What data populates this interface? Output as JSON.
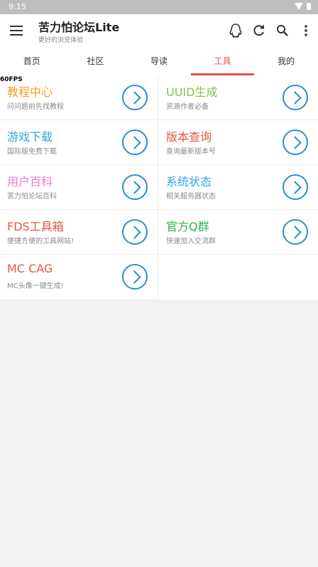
{
  "status_bar": {
    "time": "9:15"
  },
  "app_bar": {
    "title": "苦力怕论坛Lite",
    "subtitle": "更好的浏览体验",
    "actions": [
      "qq-icon",
      "refresh-icon",
      "search-icon",
      "more-vert-icon"
    ]
  },
  "tabs": [
    {
      "label": "首页"
    },
    {
      "label": "社区"
    },
    {
      "label": "导读"
    },
    {
      "label": "工具"
    },
    {
      "label": "我的"
    }
  ],
  "active_tab": "工具",
  "fps": "60FPS",
  "colors": {
    "accent": "#e84e58",
    "arrow": "#2b8fd0"
  },
  "tools": [
    {
      "title": "教程中心",
      "subtitle": "问问题前先找教程",
      "color": "#f0a020"
    },
    {
      "title": "UUID生成",
      "subtitle": "资源作者必备",
      "color": "#8bc34a"
    },
    {
      "title": "游戏下载",
      "subtitle": "国际版免费下载",
      "color": "#2fa8e0"
    },
    {
      "title": "版本查询",
      "subtitle": "查询最新版本号",
      "color": "#e8553c"
    },
    {
      "title": "用户百科",
      "subtitle": "苦力怕论坛百科",
      "color": "#f07ad0"
    },
    {
      "title": "系统状态",
      "subtitle": "相关服务器状态",
      "color": "#2fa8e0"
    },
    {
      "title": "FDS工具箱",
      "subtitle": "便捷方便的工具网站!",
      "color": "#e8553c"
    },
    {
      "title": "官方Q群",
      "subtitle": "快速加入交流群",
      "color": "#2db34a"
    },
    {
      "title": "MC CAG",
      "subtitle": "MC头像一键生成!",
      "color": "#e8553c"
    }
  ]
}
